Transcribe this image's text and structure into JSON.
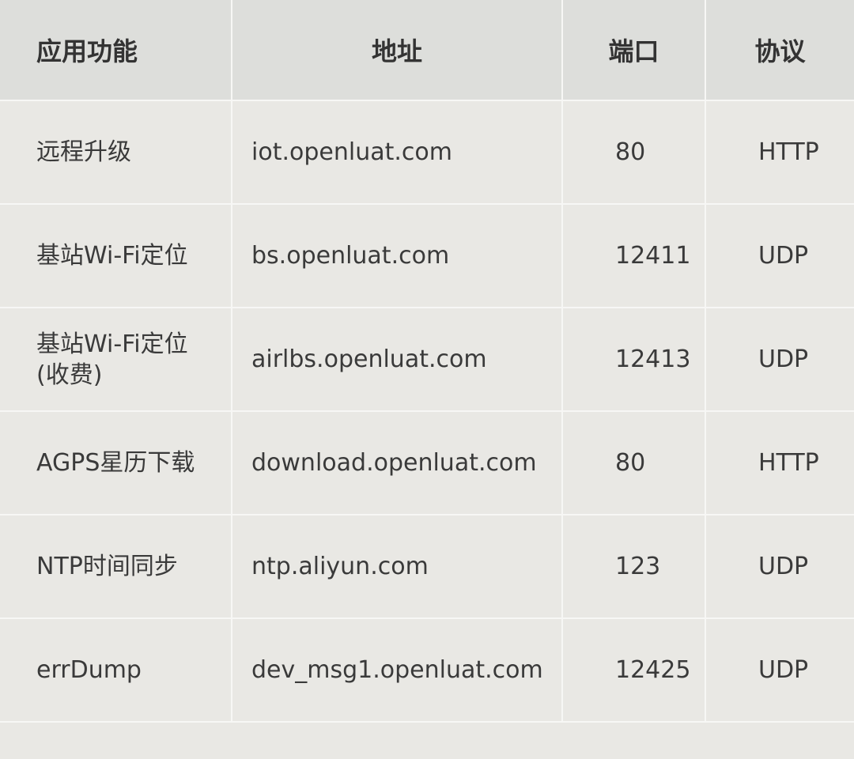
{
  "table": {
    "headers": {
      "function": "应用功能",
      "address": "地址",
      "port": "端口",
      "protocol": "协议"
    },
    "rows": [
      {
        "function": "远程升级",
        "address": "iot.openluat.com",
        "port": "80",
        "protocol": "HTTP"
      },
      {
        "function": "基站Wi-Fi定位",
        "address": "bs.openluat.com",
        "port": "12411",
        "protocol": "UDP"
      },
      {
        "function": "基站Wi-Fi定位\n(收费)",
        "address": "airlbs.openluat.com",
        "port": "12413",
        "protocol": "UDP"
      },
      {
        "function": "AGPS星历下载",
        "address": "download.openluat.com",
        "port": "80",
        "protocol": "HTTP"
      },
      {
        "function": "NTP时间同步",
        "address": "ntp.aliyun.com",
        "port": "123",
        "protocol": "UDP"
      },
      {
        "function": "errDump",
        "address": "dev_msg1.openluat.com",
        "port": "12425",
        "protocol": "UDP"
      }
    ]
  }
}
